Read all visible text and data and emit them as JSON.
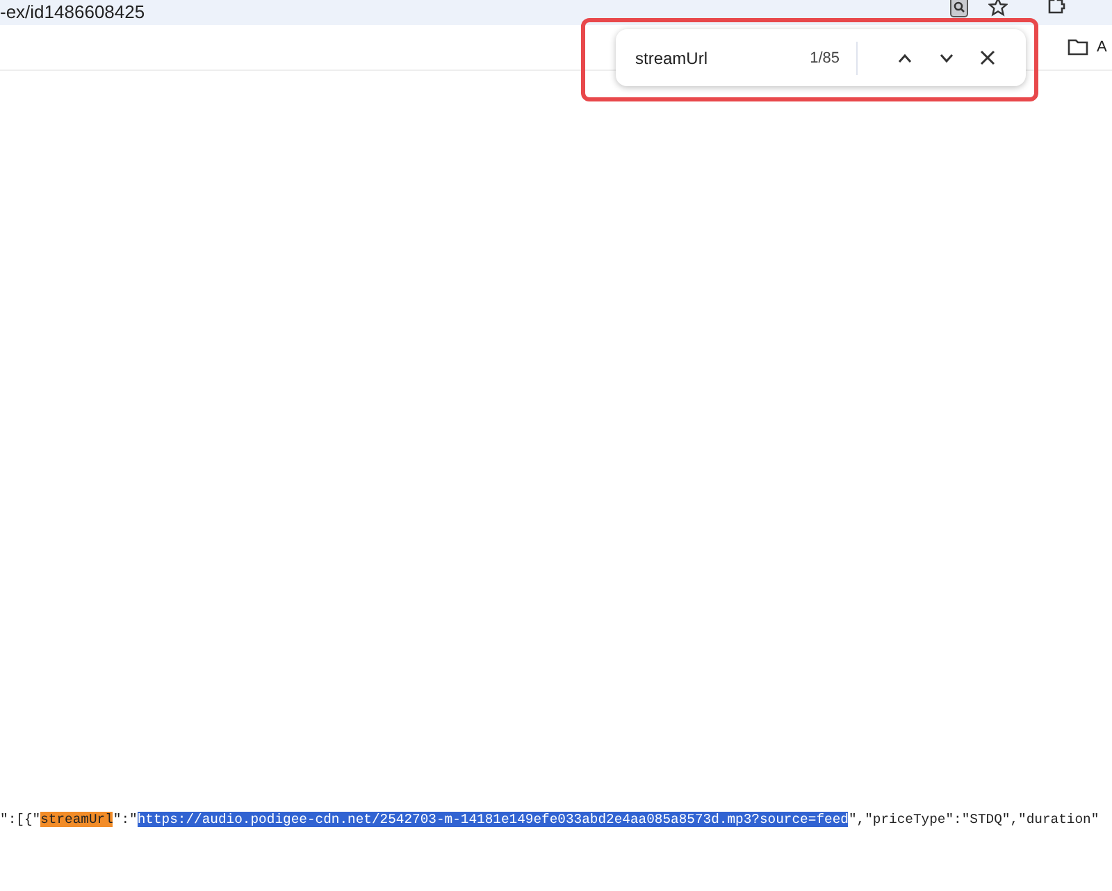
{
  "address_bar": {
    "url": "-ex/id1486608425"
  },
  "bookmarks_bar": {
    "folder_label": "A"
  },
  "find_bar": {
    "query": "streamUrl",
    "count": "1/85"
  },
  "code_line": [
    {
      "kind": "plain",
      "text": "\":[{\""
    },
    {
      "kind": "match",
      "text": "streamUrl"
    },
    {
      "kind": "plain",
      "text": "\":\""
    },
    {
      "kind": "selection",
      "text": "https://audio.podigee-cdn.net/2542703-m-14181e149efe033abd2e4aa085a8573d.mp3?source=feed"
    },
    {
      "kind": "plain",
      "text": "\",\"priceType\":\"STDQ\",\"duration\""
    }
  ]
}
